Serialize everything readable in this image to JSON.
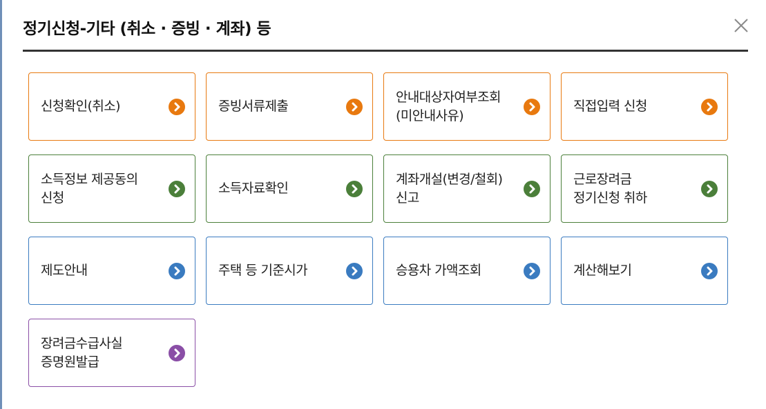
{
  "dialog": {
    "title": "정기신청-기타 (취소 · 증빙 · 계좌) 등",
    "close_icon": "close-icon"
  },
  "colors": {
    "orange": "#e8790f",
    "green": "#4b7f3a",
    "blue": "#3a7bc0",
    "purple": "#8a4ea6"
  },
  "menu": [
    {
      "label": "신청확인(취소)",
      "color": "orange",
      "icon": "chevron-right-icon"
    },
    {
      "label": "증빙서류제출",
      "color": "orange",
      "icon": "chevron-right-icon"
    },
    {
      "label": "안내대상자여부조회\n(미안내사유)",
      "color": "orange",
      "icon": "chevron-right-icon"
    },
    {
      "label": "직접입력 신청",
      "color": "orange",
      "icon": "chevron-right-icon"
    },
    {
      "label": "소득정보 제공동의\n신청",
      "color": "green",
      "icon": "chevron-right-icon"
    },
    {
      "label": "소득자료확인",
      "color": "green",
      "icon": "chevron-right-icon"
    },
    {
      "label": "계좌개설(변경/철회)\n신고",
      "color": "green",
      "icon": "chevron-right-icon"
    },
    {
      "label": "근로장려금\n정기신청 취하",
      "color": "green",
      "icon": "chevron-right-icon"
    },
    {
      "label": "제도안내",
      "color": "blue",
      "icon": "chevron-right-icon"
    },
    {
      "label": "주택 등 기준시가",
      "color": "blue",
      "icon": "chevron-right-icon"
    },
    {
      "label": "승용차 가액조회",
      "color": "blue",
      "icon": "chevron-right-icon"
    },
    {
      "label": "계산해보기",
      "color": "blue",
      "icon": "chevron-right-icon"
    },
    {
      "label": "장려금수급사실\n증명원발급",
      "color": "purple",
      "icon": "chevron-right-icon"
    }
  ]
}
